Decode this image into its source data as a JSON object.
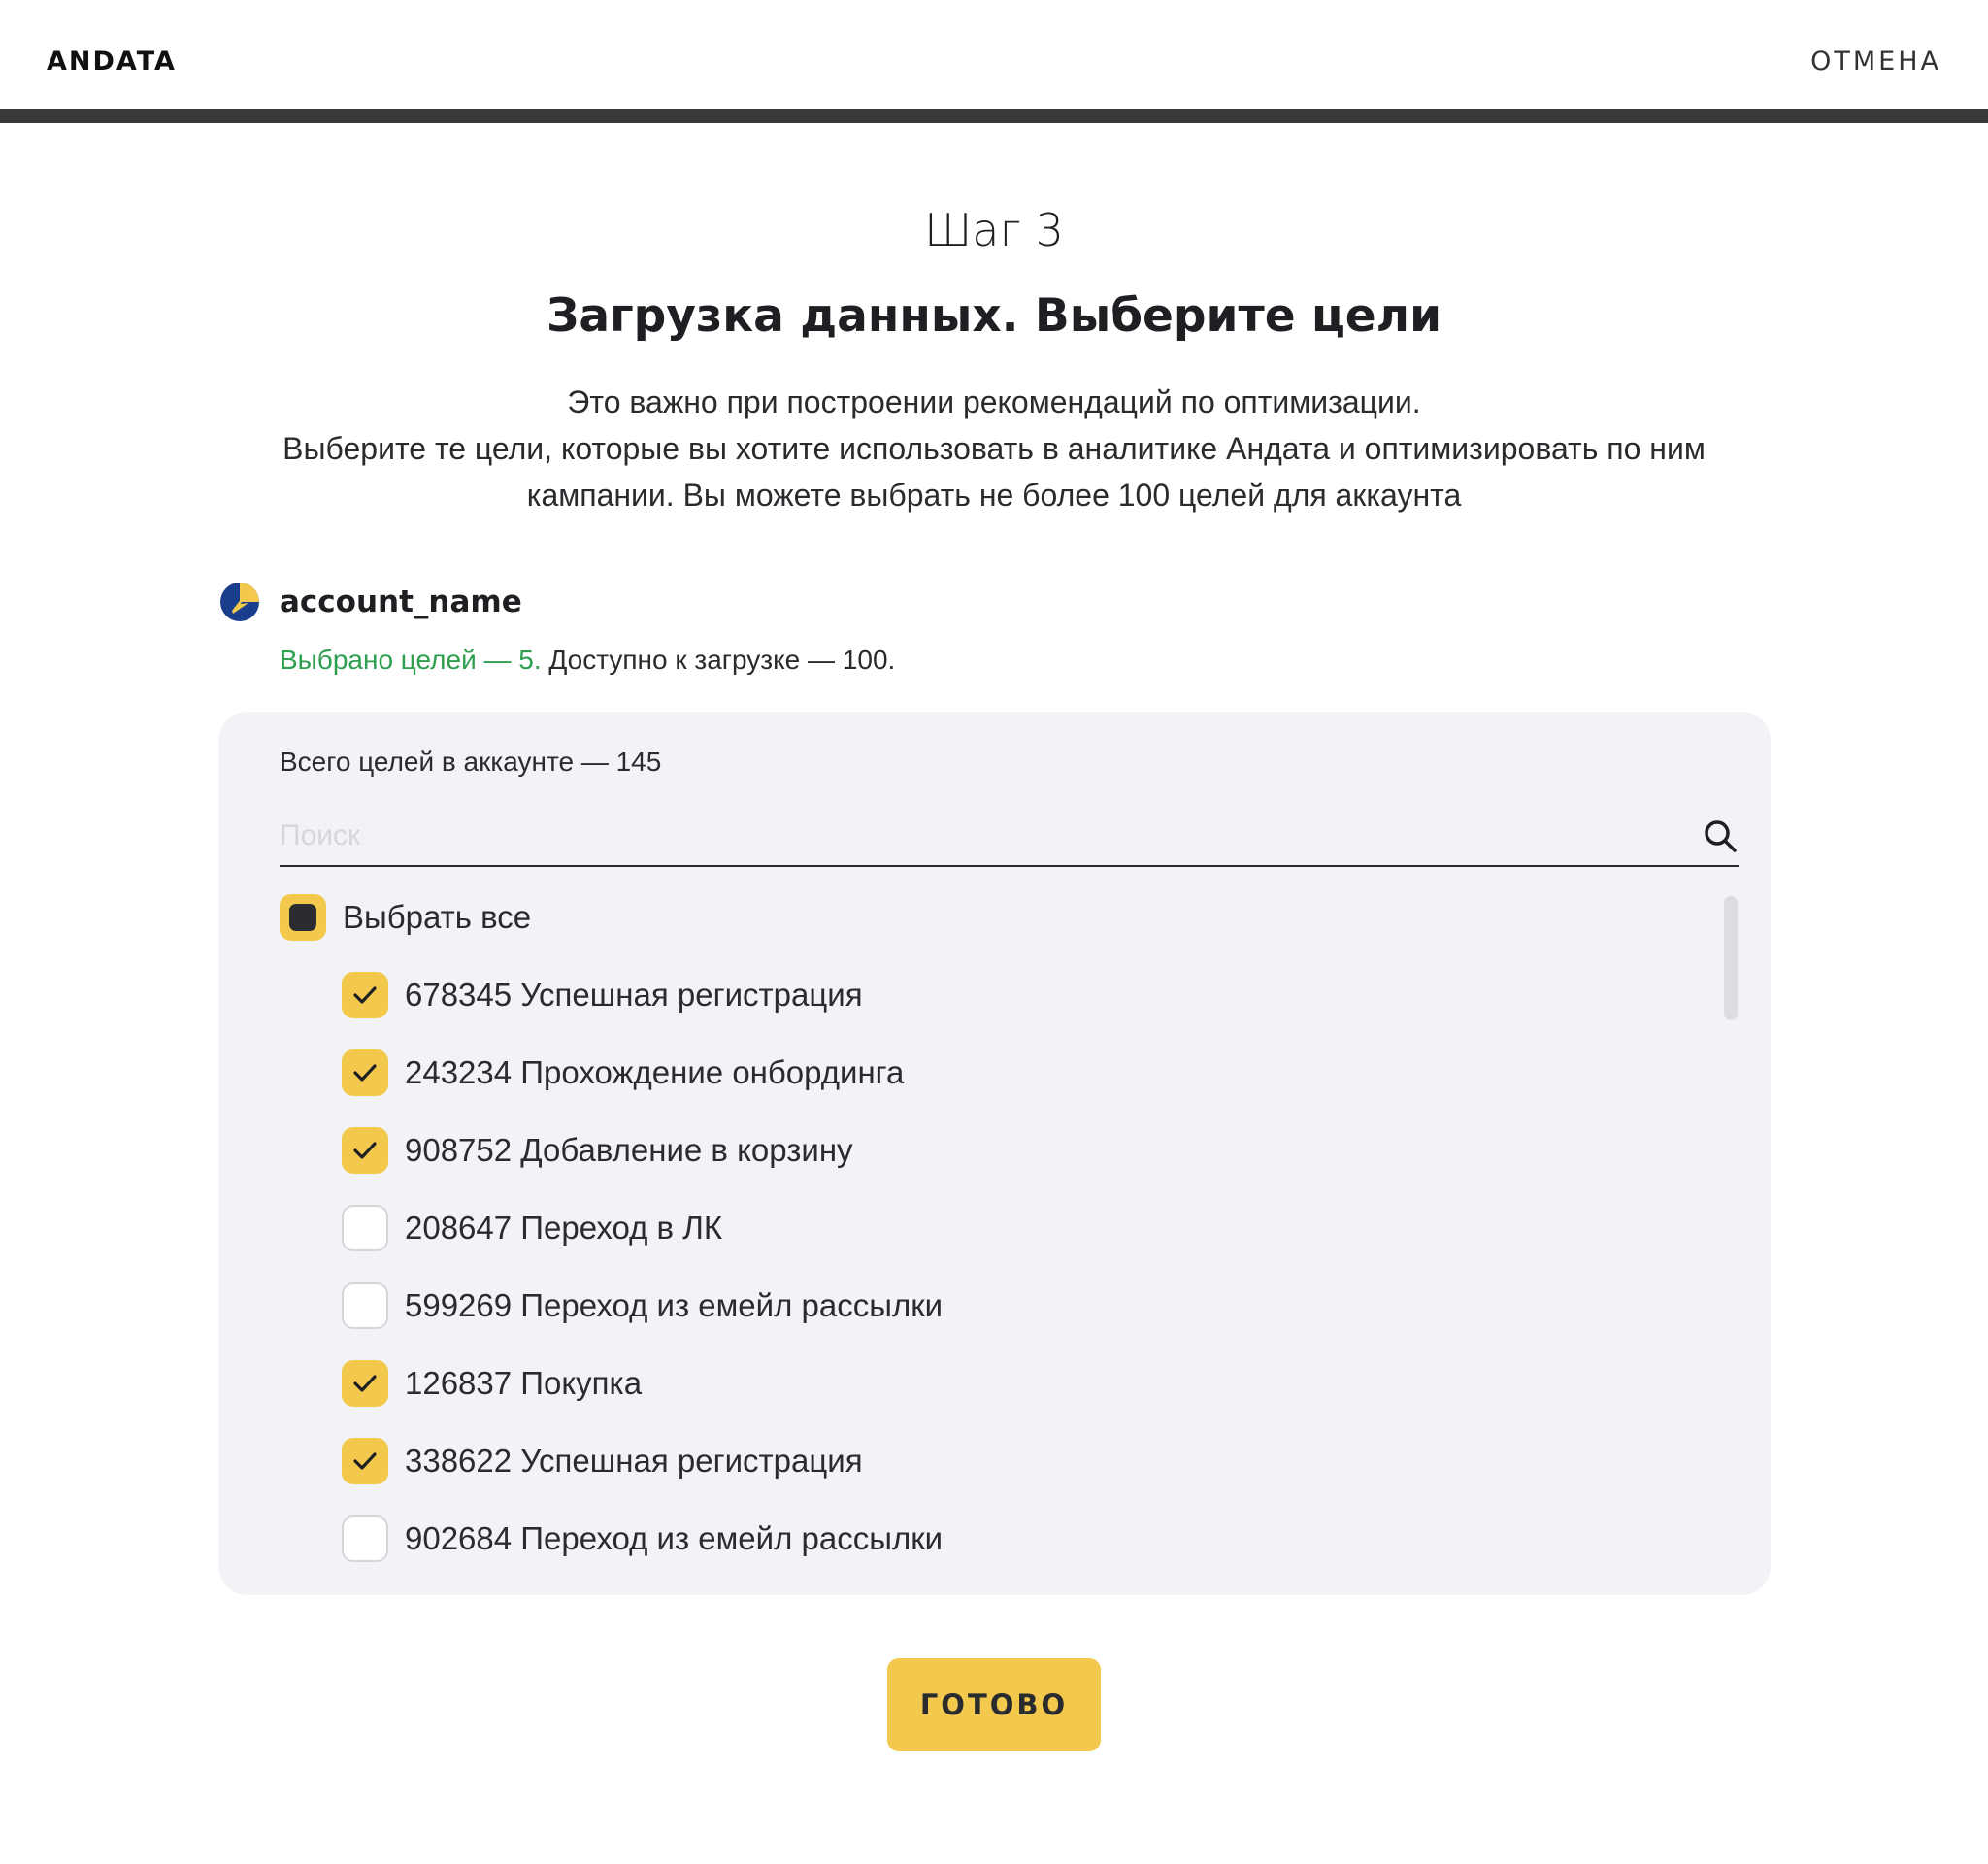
{
  "header": {
    "logo": "ANDATA",
    "cancel_label": "ОТМЕНА"
  },
  "page": {
    "step": "Шаг 3",
    "title": "Загрузка данных. Выберите цели",
    "description": [
      "Это важно при построении рекомендаций по оптимизации.",
      "Выберите те цели, которые вы хотите использовать в аналитике Андата и оптимизировать по ним",
      "кампании. Вы можете выбрать не более 100 целей для аккаунта"
    ]
  },
  "account": {
    "name": "account_name",
    "selected_text": "Выбрано целей — 5.",
    "available_text": "Доступно к загрузке — 100.",
    "brand_colors": {
      "blue": "#1a3e8c",
      "yellow": "#f2c94c"
    }
  },
  "goals_panel": {
    "total_text": "Всего целей в аккаунте — 145",
    "search_placeholder": "Поиск",
    "search_value": "",
    "select_all": {
      "label": "Выбрать все",
      "state": "partial"
    },
    "items": [
      {
        "id": "678345",
        "name": "Успешная регистрация",
        "checked": true
      },
      {
        "id": "243234",
        "name": "Прохождение онбординга",
        "checked": true
      },
      {
        "id": "908752",
        "name": "Добавление в корзину",
        "checked": true
      },
      {
        "id": "208647",
        "name": "Переход в ЛК",
        "checked": false
      },
      {
        "id": "599269",
        "name": "Переход из емейл рассылки",
        "checked": false
      },
      {
        "id": "126837",
        "name": "Покупка",
        "checked": true
      },
      {
        "id": "338622",
        "name": "Успешная регистрация",
        "checked": true
      },
      {
        "id": "902684",
        "name": "Переход из емейл рассылки",
        "checked": false
      }
    ]
  },
  "footer": {
    "done_label": "ГОТОВО"
  },
  "colors": {
    "accent": "#f2c94c",
    "panel_bg": "#f2f3f6",
    "success_text": "#2e9e4f",
    "top_rule": "#38393b"
  }
}
